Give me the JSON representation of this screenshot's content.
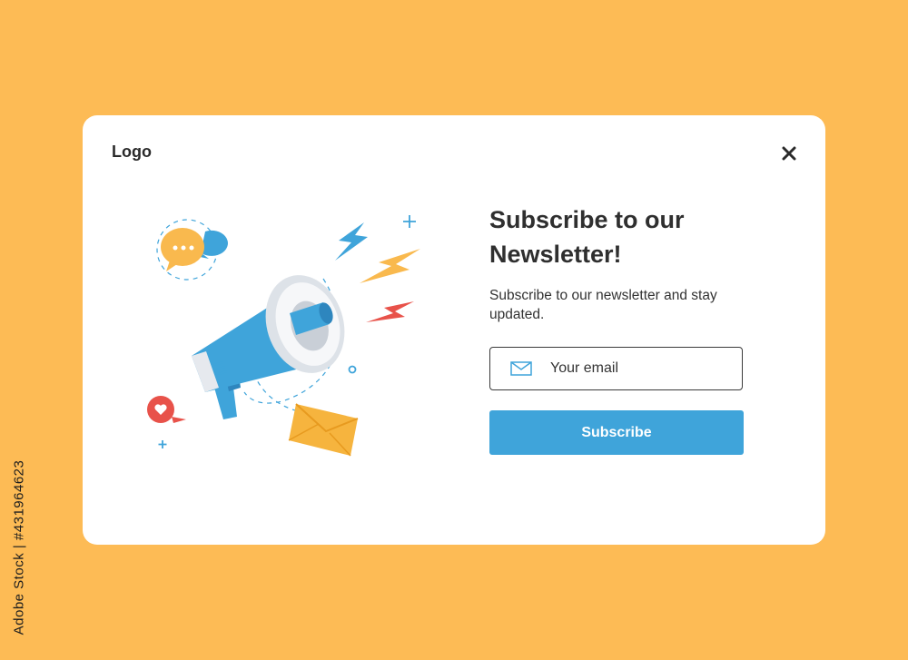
{
  "stock_id": "Adobe Stock | #431964623",
  "modal": {
    "logo": "Logo",
    "title": "Subscribe to our Newsletter!",
    "subtitle": "Subscribe to our newsletter and stay updated.",
    "email_placeholder": "Your email",
    "subscribe_label": "Subscribe"
  },
  "icons": {
    "close": "close-icon",
    "mail": "mail-icon",
    "megaphone": "megaphone-icon",
    "chat": "chat-bubble-icon",
    "heart": "heart-bubble-icon",
    "envelope": "envelope-icon",
    "lightning": "lightning-icon"
  },
  "colors": {
    "background": "#FDBB55",
    "modal": "#FFFFFF",
    "accent": "#3FA4DA",
    "text": "#2F2F2F"
  }
}
